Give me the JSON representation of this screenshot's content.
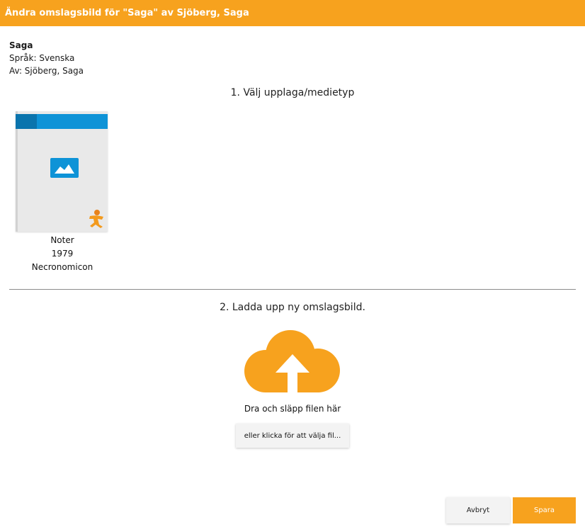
{
  "header": {
    "title": "Ändra omslagsbild för \"Saga\" av Sjöberg, Saga",
    "color": "#f7a21e"
  },
  "work": {
    "title": "Saga",
    "language": "Språk: Svenska",
    "author": "Av: Sjöberg, Saga"
  },
  "step1": {
    "label": "1. Välj upplaga/medietyp"
  },
  "editions": [
    {
      "type": "Noter",
      "year": "1979",
      "publisher": "Necronomicon",
      "cover_icon": "image-placeholder-icon",
      "badge_icon": "sheet-music-badge-icon"
    }
  ],
  "step2": {
    "label": "2. Ladda upp ny omslagsbild."
  },
  "upload": {
    "icon": "cloud-upload-icon",
    "drop_text": "Dra och släpp filen här",
    "choose_label": "eller klicka för att välja fil..."
  },
  "footer": {
    "cancel_label": "Avbryt",
    "save_label": "Spara"
  }
}
